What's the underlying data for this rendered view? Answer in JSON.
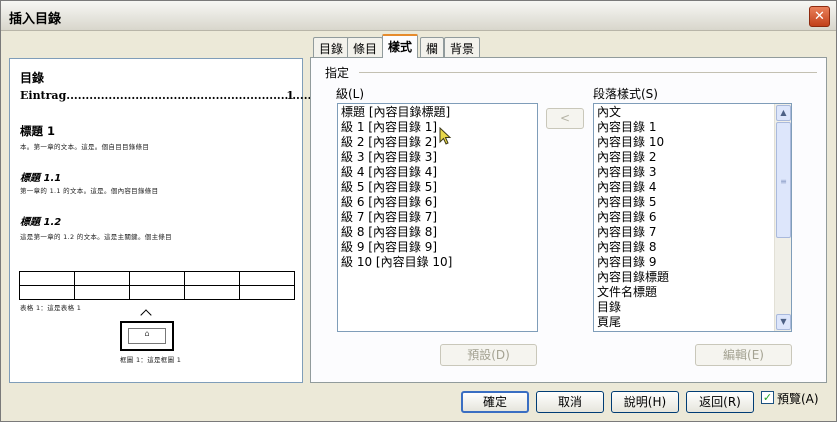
{
  "dialog": {
    "title": "插入目錄",
    "close_glyph": "✕"
  },
  "tabs": [
    {
      "label": "目錄"
    },
    {
      "label": "條目"
    },
    {
      "label": "樣式"
    },
    {
      "label": "欄"
    },
    {
      "label": "背景"
    }
  ],
  "preview": {
    "title": "目錄",
    "entry": "Eintrag",
    "entry_page": "1",
    "heading1": "標題 1",
    "body1": "本。第一章的文本。這是。個自目目錄條目",
    "heading11": "標題 1.1",
    "body11": "第一章的 1.1 的文本。這是。個內容目錄條目",
    "heading12": "標題 1.2",
    "body12": "這是第一章的 1.2 的文本。這是主關鍵。個主條目",
    "table_caption": "表格 1：這是表格 1",
    "frame_caption": "框圖 1：這是框圖 1"
  },
  "style_panel": {
    "group_label": "指定",
    "levels_label": "級(L)",
    "para_styles_label": "段落樣式(S)",
    "levels": [
      "標題 [內容目錄標題]",
      "級 1 [內容目錄 1]",
      "級 2 [內容目錄 2]",
      "級 3 [內容目錄 3]",
      "級 4 [內容目錄 4]",
      "級 5 [內容目錄 5]",
      "級 6 [內容目錄 6]",
      "級 7 [內容目錄 7]",
      "級 8 [內容目錄 8]",
      "級 9 [內容目錄 9]",
      "級 10 [內容目錄 10]"
    ],
    "paragraph_styles": [
      "內文",
      "內容目錄 1",
      "內容目錄 10",
      "內容目錄 2",
      "內容目錄 3",
      "內容目錄 4",
      "內容目錄 5",
      "內容目錄 6",
      "內容目錄 7",
      "內容目錄 8",
      "內容目錄 9",
      "內容目錄標題",
      "文件名標題",
      "目錄",
      "頁尾"
    ],
    "assign_arrow": "<",
    "default_button": "預設(D)",
    "edit_button": "編輯(E)"
  },
  "footer": {
    "ok": "確定",
    "cancel": "取消",
    "help": "說明(H)",
    "reset": "返回(R)",
    "preview_label": "預覽(A)",
    "preview_checked": true
  },
  "colors": {
    "accent_tab": "#e68b2c",
    "checkmark": "#21a121",
    "close": "#c2401a"
  }
}
